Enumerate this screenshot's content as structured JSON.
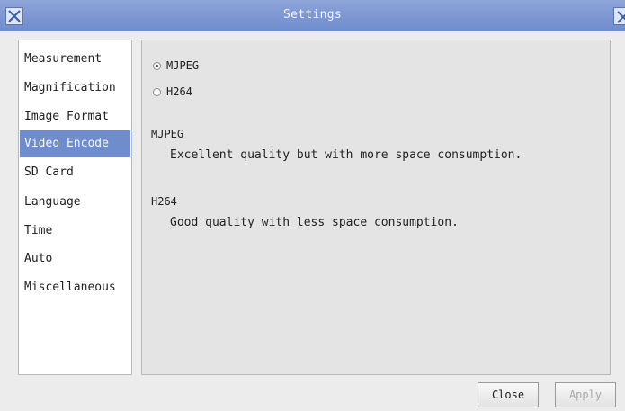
{
  "window": {
    "title": "Settings"
  },
  "sidebar": {
    "items": [
      {
        "label": "Measurement"
      },
      {
        "label": "Magnification"
      },
      {
        "label": "Image Format"
      },
      {
        "label": "Video Encode",
        "active": true
      },
      {
        "label": "SD Card"
      },
      {
        "label": "Language"
      },
      {
        "label": "Time"
      },
      {
        "label": "Auto"
      },
      {
        "label": "Miscellaneous"
      }
    ]
  },
  "encode": {
    "options": [
      {
        "label": "MJPEG",
        "checked": true
      },
      {
        "label": "H264",
        "checked": false
      }
    ],
    "descriptions": [
      {
        "heading": "MJPEG",
        "text": "Excellent quality but with more space consumption."
      },
      {
        "heading": "H264",
        "text": "Good quality with less space consumption."
      }
    ]
  },
  "buttons": {
    "close": "Close",
    "apply": "Apply"
  },
  "colors": {
    "titlebar": "#6f8ccd",
    "selected": "#6f8ccd"
  },
  "icons": {
    "app": "x-logo-icon",
    "close": "close-icon"
  }
}
